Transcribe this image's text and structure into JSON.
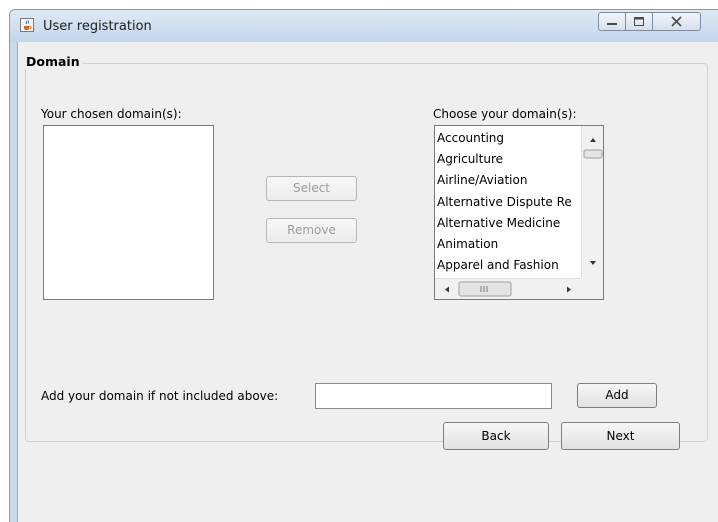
{
  "window": {
    "title": "User registration",
    "icon": "java-cup-icon"
  },
  "colors": {
    "title_bar": "#c9d9ea",
    "content_bg": "#efefef",
    "disabled_text": "#9c9c9c"
  },
  "domain_group": {
    "title": "Domain",
    "chosen_label": "Your chosen domain(s):",
    "choose_label": "Choose your domain(s):",
    "chosen_items": [],
    "available_items": [
      "Accounting",
      "Agriculture",
      "Airline/Aviation",
      "Alternative Dispute Re",
      "Alternative Medicine",
      "Animation",
      "Apparel and Fashion"
    ],
    "select_label": "Select",
    "remove_label": "Remove"
  },
  "add_domain": {
    "label": "Add your domain if not included above:",
    "value": "",
    "add_label": "Add"
  },
  "navigation": {
    "back_label": "Back",
    "next_label": "Next"
  }
}
